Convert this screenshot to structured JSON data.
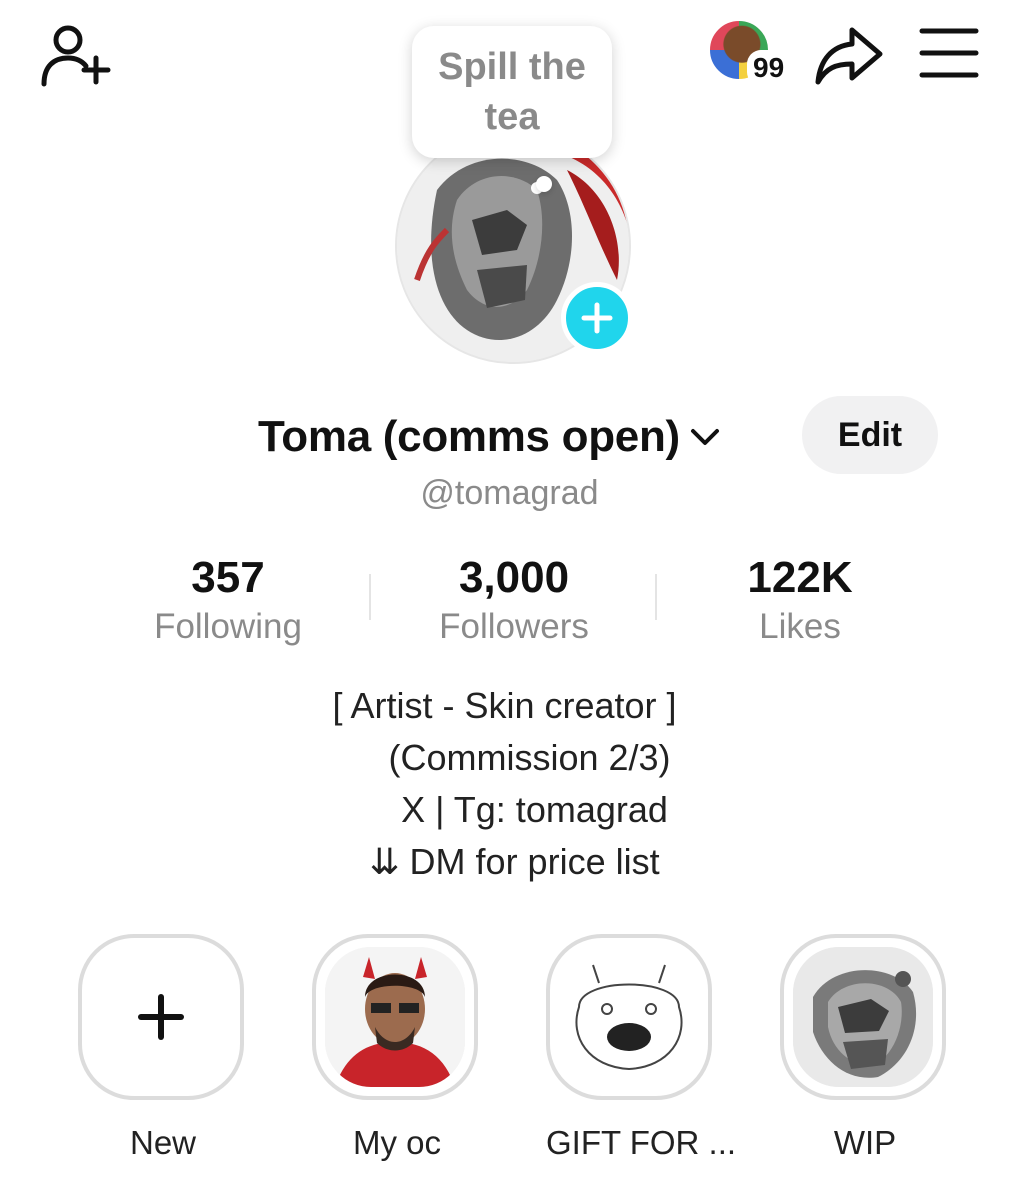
{
  "top_bar": {
    "inbox_count": "99",
    "tea_bubble": "Spill the tea"
  },
  "profile": {
    "display_name": "Toma (comms open)",
    "username": "@tomagrad",
    "edit_label": "Edit"
  },
  "stats": [
    {
      "value": "357",
      "label": "Following"
    },
    {
      "value": "3,000",
      "label": "Followers"
    },
    {
      "value": "122K",
      "label": "Likes"
    }
  ],
  "bio": [
    "[ Artist - Skin creator ]",
    "(Commission 2/3)",
    "X | Tg: tomagrad",
    "⇊ DM for price list"
  ],
  "highlights": [
    {
      "label": "New"
    },
    {
      "label": "My oc"
    },
    {
      "label": "GIFT FOR ..."
    },
    {
      "label": "WIP"
    }
  ],
  "colors": {
    "accent_plus": "#20d5ec",
    "muted_text": "#8a8a8a",
    "edit_bg": "#f1f1f2"
  },
  "icons": [
    "add-friend-icon",
    "share-icon",
    "menu-icon",
    "chevron-down-icon",
    "plus-icon"
  ]
}
